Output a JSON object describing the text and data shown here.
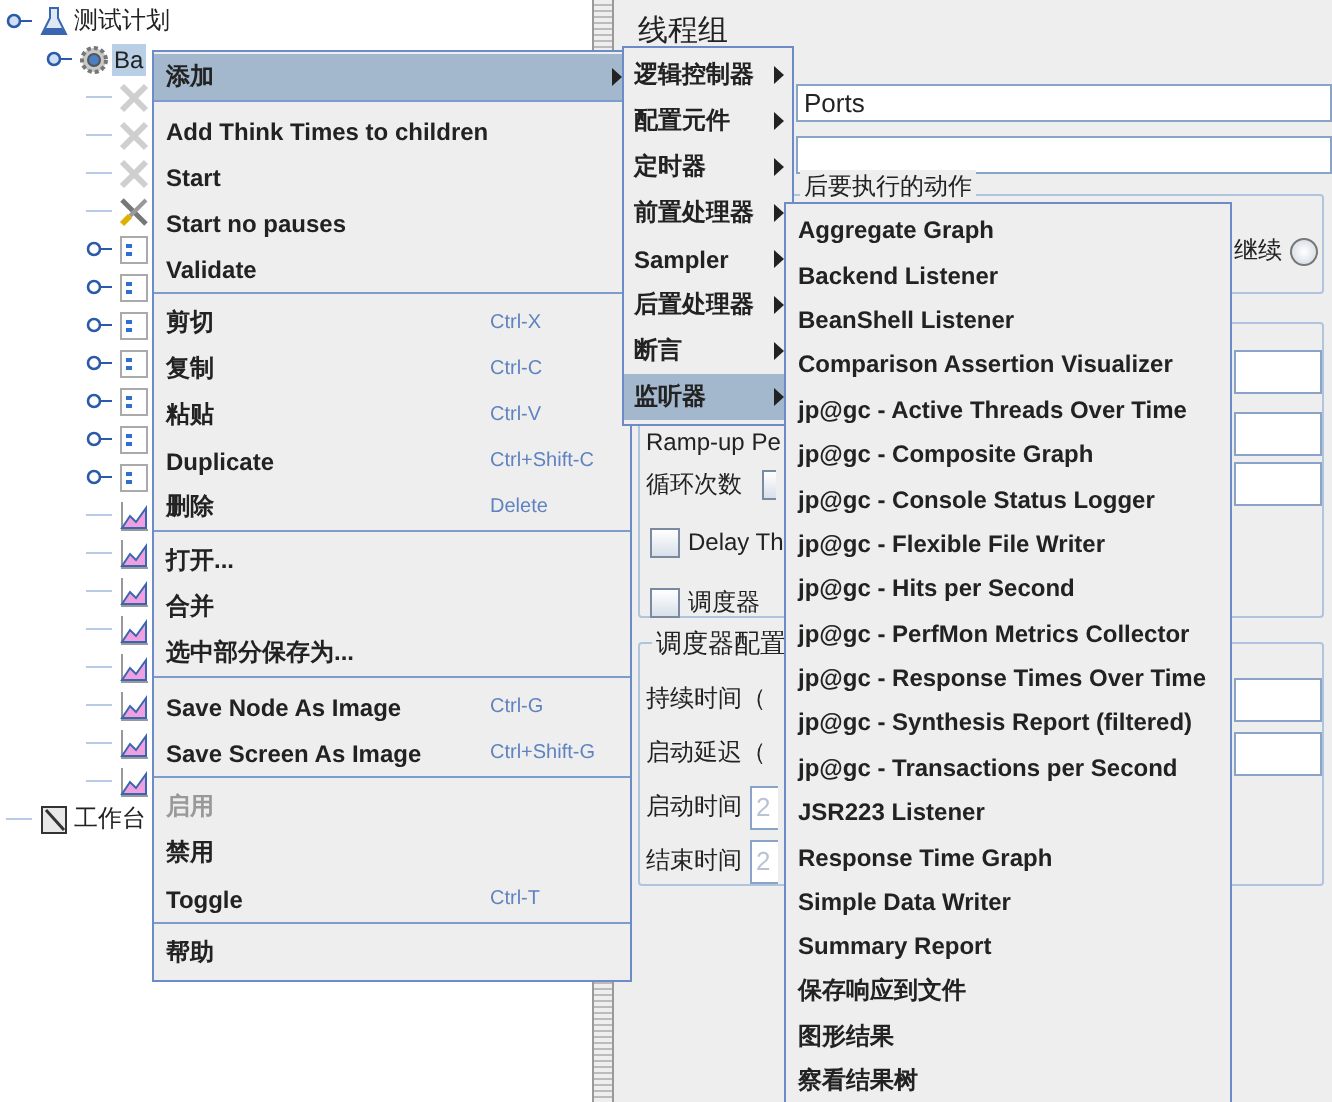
{
  "tree": [
    {
      "label": "测试计划",
      "kind": "plan",
      "selected": false,
      "collapsed": false,
      "children": [
        {
          "label": "Ba",
          "kind": "thread_group",
          "selected": true,
          "collapsed": false,
          "children": [
            {
              "kind": "config",
              "selected": false,
              "collapsed": false
            },
            {
              "kind": "config",
              "selected": false,
              "collapsed": false
            },
            {
              "kind": "config",
              "selected": false,
              "collapsed": false
            },
            {
              "kind": "tool",
              "selected": false,
              "collapsed": false
            },
            {
              "kind": "sampler",
              "selected": false,
              "collapsed": true
            },
            {
              "kind": "sampler",
              "selected": false,
              "collapsed": true
            },
            {
              "kind": "sampler",
              "selected": false,
              "collapsed": true
            },
            {
              "kind": "sampler",
              "selected": false,
              "collapsed": true
            },
            {
              "kind": "sampler",
              "selected": false,
              "collapsed": true
            },
            {
              "kind": "sampler",
              "selected": false,
              "collapsed": true
            },
            {
              "kind": "sampler",
              "selected": false,
              "collapsed": true
            },
            {
              "kind": "listener",
              "selected": false,
              "collapsed": false
            },
            {
              "kind": "listener",
              "selected": false,
              "collapsed": false
            },
            {
              "kind": "listener",
              "selected": false,
              "collapsed": false
            },
            {
              "kind": "listener",
              "selected": false,
              "collapsed": false
            },
            {
              "kind": "listener",
              "selected": false,
              "collapsed": false
            },
            {
              "kind": "listener",
              "selected": false,
              "collapsed": false
            },
            {
              "kind": "listener",
              "selected": false,
              "collapsed": false
            },
            {
              "kind": "listener",
              "selected": false,
              "collapsed": false
            }
          ]
        }
      ]
    },
    {
      "label": "工作台",
      "kind": "workbench",
      "selected": false,
      "collapsed": false
    }
  ],
  "thread_group": {
    "title": "线程组",
    "name_value": "Ports",
    "error_action_title": "后要执行的动作",
    "continue_option": {
      "label": "继续",
      "selected": false
    },
    "ramp_up_label": "Ramp-up Pe",
    "loop_label": "循环次数",
    "loop_forever_checked": false,
    "delay_checkbox": {
      "label": "Delay Th",
      "checked": false
    },
    "scheduler_checkbox": {
      "label": "调度器",
      "checked": false
    },
    "scheduler_config": {
      "title": "调度器配置",
      "rows": [
        {
          "label": "持续时间（"
        },
        {
          "label": "启动延迟（"
        },
        {
          "label": "启动时间",
          "value": "2"
        },
        {
          "label": "结束时间",
          "value": "2"
        }
      ]
    }
  },
  "context_menu": {
    "groups": [
      [
        {
          "label": "添加",
          "kind": "submenu",
          "selected": true,
          "disabled": false
        }
      ],
      [
        {
          "label": "Add Think Times to children",
          "kind": "command",
          "selected": false,
          "disabled": false
        },
        {
          "label": "Start",
          "kind": "command",
          "selected": false,
          "disabled": false
        },
        {
          "label": "Start no pauses",
          "kind": "command",
          "selected": false,
          "disabled": false
        },
        {
          "label": "Validate",
          "kind": "command",
          "selected": false,
          "disabled": false
        }
      ],
      [
        {
          "label": "剪切",
          "shortcut": "Ctrl-X",
          "kind": "command",
          "selected": false,
          "disabled": false
        },
        {
          "label": "复制",
          "shortcut": "Ctrl-C",
          "kind": "command",
          "selected": false,
          "disabled": false
        },
        {
          "label": "粘贴",
          "shortcut": "Ctrl-V",
          "kind": "command",
          "selected": false,
          "disabled": false
        },
        {
          "label": "Duplicate",
          "shortcut": "Ctrl+Shift-C",
          "kind": "command",
          "selected": false,
          "disabled": false
        },
        {
          "label": "删除",
          "shortcut": "Delete",
          "kind": "command",
          "selected": false,
          "disabled": false
        }
      ],
      [
        {
          "label": "打开...",
          "kind": "command",
          "selected": false,
          "disabled": false
        },
        {
          "label": "合并",
          "kind": "command",
          "selected": false,
          "disabled": false
        },
        {
          "label": "选中部分保存为...",
          "kind": "command",
          "selected": false,
          "disabled": false
        }
      ],
      [
        {
          "label": "Save Node As Image",
          "shortcut": "Ctrl-G",
          "kind": "command",
          "selected": false,
          "disabled": false
        },
        {
          "label": "Save Screen As Image",
          "shortcut": "Ctrl+Shift-G",
          "kind": "command",
          "selected": false,
          "disabled": false
        }
      ],
      [
        {
          "label": "启用",
          "kind": "command",
          "selected": false,
          "disabled": true
        },
        {
          "label": "禁用",
          "kind": "command",
          "selected": false,
          "disabled": false
        },
        {
          "label": "Toggle",
          "shortcut": "Ctrl-T",
          "kind": "command",
          "selected": false,
          "disabled": false
        }
      ],
      [
        {
          "label": "帮助",
          "kind": "command",
          "selected": false,
          "disabled": false
        }
      ]
    ]
  },
  "add_submenu": [
    {
      "label": "逻辑控制器",
      "selected": false
    },
    {
      "label": "配置元件",
      "selected": false
    },
    {
      "label": "定时器",
      "selected": false
    },
    {
      "label": "前置处理器",
      "selected": false
    },
    {
      "label": "Sampler",
      "selected": false
    },
    {
      "label": "后置处理器",
      "selected": false
    },
    {
      "label": "断言",
      "selected": false
    },
    {
      "label": "监听器",
      "selected": true
    }
  ],
  "listener_submenu": [
    "Aggregate Graph",
    "Backend Listener",
    "BeanShell Listener",
    "Comparison Assertion Visualizer",
    "jp@gc - Active Threads Over Time",
    "jp@gc - Composite Graph",
    "jp@gc - Console Status Logger",
    "jp@gc - Flexible File Writer",
    "jp@gc - Hits per Second",
    "jp@gc - PerfMon Metrics Collector",
    "jp@gc - Response Times Over Time",
    "jp@gc - Synthesis Report (filtered)",
    "jp@gc - Transactions per Second",
    "JSR223 Listener",
    "Response Time Graph",
    "Simple Data Writer",
    "Summary Report",
    "保存响应到文件",
    "图形结果",
    "察看结果树"
  ]
}
